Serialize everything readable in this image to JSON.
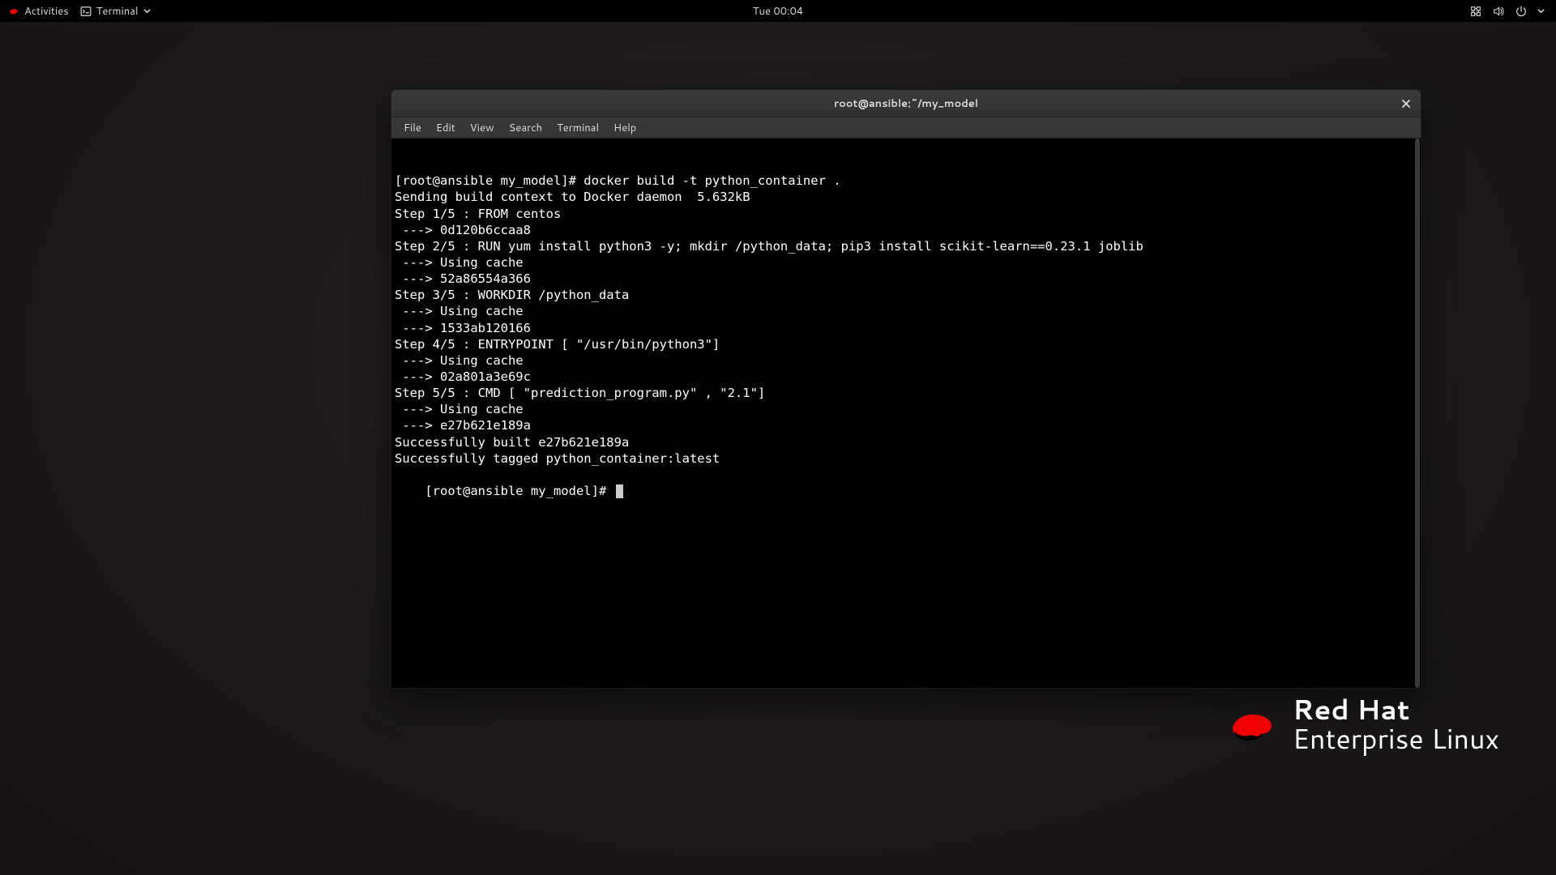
{
  "topbar": {
    "activities": "Activities",
    "app_name": "Terminal",
    "clock": "Tue 00:04"
  },
  "window": {
    "title": "root@ansible:~/my_model"
  },
  "menubar": {
    "file": "File",
    "edit": "Edit",
    "view": "View",
    "search": "Search",
    "terminal": "Terminal",
    "help": "Help"
  },
  "terminal_lines": [
    "[root@ansible my_model]# docker build -t python_container .",
    "Sending build context to Docker daemon  5.632kB",
    "Step 1/5 : FROM centos",
    " ---> 0d120b6ccaa8",
    "Step 2/5 : RUN yum install python3 -y; mkdir /python_data; pip3 install scikit-learn==0.23.1 joblib",
    " ---> Using cache",
    " ---> 52a86554a366",
    "Step 3/5 : WORKDIR /python_data",
    " ---> Using cache",
    " ---> 1533ab120166",
    "Step 4/5 : ENTRYPOINT [ \"/usr/bin/python3\"]",
    " ---> Using cache",
    " ---> 02a801a3e69c",
    "Step 5/5 : CMD [ \"prediction_program.py\" , \"2.1\"]",
    " ---> Using cache",
    " ---> e27b621e189a",
    "Successfully built e27b621e189a",
    "Successfully tagged python_container:latest"
  ],
  "prompt": "[root@ansible my_model]# ",
  "branding": {
    "line1": "Red Hat",
    "line2": "Enterprise Linux"
  }
}
